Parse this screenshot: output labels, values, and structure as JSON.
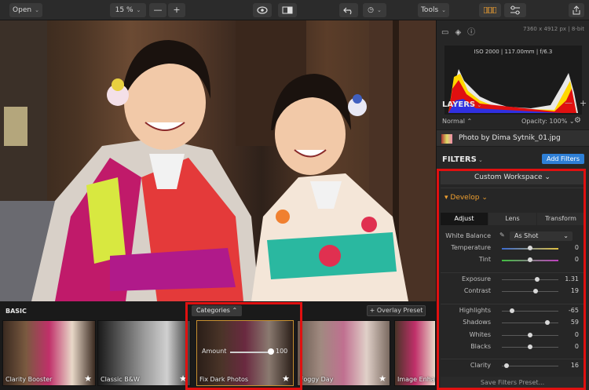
{
  "toolbar": {
    "open_label": "Open",
    "zoom_label": "15 %",
    "zoom_minus": "—",
    "zoom_plus": "+",
    "tools_label": "Tools"
  },
  "panel": {
    "image_info": "7360 x 4912 px | 8-bit",
    "histogram_info": "ISO 2000 | 117.00mm | f/6.3",
    "layers_title": "LAYERS",
    "blend_mode": "Normal",
    "opacity": "Opacity: 100%",
    "layer_name": "Photo by Dima Sytnik_01.jpg",
    "filters_title": "FILTERS",
    "add_filters": "Add Filters",
    "workspace": "Custom Workspace",
    "develop": "Develop",
    "tabs": [
      "Adjust",
      "Lens",
      "Transform"
    ],
    "white_balance_label": "White Balance",
    "white_balance_value": "As Shot",
    "rows": {
      "temperature": {
        "label": "Temperature",
        "value": "0",
        "pos": 0.5
      },
      "tint": {
        "label": "Tint",
        "value": "0",
        "pos": 0.5
      },
      "exposure": {
        "label": "Exposure",
        "value": "1.31",
        "pos": 0.63
      },
      "contrast": {
        "label": "Contrast",
        "value": "19",
        "pos": 0.6
      },
      "highlights": {
        "label": "Highlights",
        "value": "-65",
        "pos": 0.18
      },
      "shadows": {
        "label": "Shadows",
        "value": "59",
        "pos": 0.8
      },
      "whites": {
        "label": "Whites",
        "value": "0",
        "pos": 0.5
      },
      "blacks": {
        "label": "Blacks",
        "value": "0",
        "pos": 0.5
      },
      "clarity": {
        "label": "Clarity",
        "value": "16",
        "pos": 0.08
      }
    },
    "save_presets": "Save Filters Preset..."
  },
  "presets": {
    "title": "BASIC",
    "categories": "Categories",
    "overlay": "+ Overlay Preset",
    "amount_label": "Amount",
    "amount_value": "100",
    "amount_pos": 1.0,
    "items": [
      "Clarity Booster",
      "Classic B&W",
      "Fix Dark Photos",
      "Foggy Day",
      "Image Enhancer"
    ]
  },
  "colors": {
    "accent_blue": "#2e7fd6",
    "develop_orange": "#f0a030",
    "highlight_red": "#e01010"
  }
}
